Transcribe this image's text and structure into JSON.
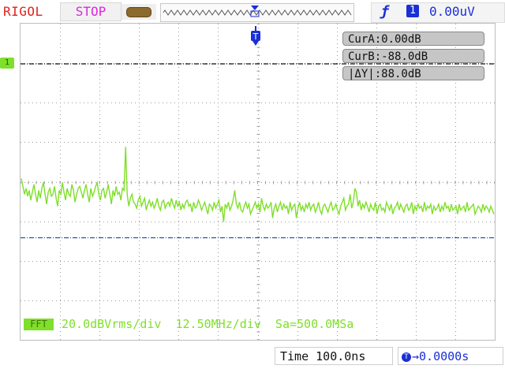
{
  "header": {
    "brand": "RIGOL",
    "run_state": "STOP",
    "trigger_source": "1",
    "trigger_level": "0.00uV"
  },
  "cursors": {
    "cur_a": "CurA:0.00dB",
    "cur_b": "CurB:-88.0dB",
    "delta_y": "|ΔY|:88.0dB"
  },
  "channel": {
    "marker": "1"
  },
  "fft": {
    "label": "FFT",
    "info": "20.0dBVrms/div  12.50MHz/div  Sa=500.0MSa"
  },
  "footer": {
    "timebase": "Time 100.0ns",
    "offset": "→0.0000s",
    "offset_marker": "T"
  },
  "colors": {
    "brand": "#e0201e",
    "stop": "#e026e0",
    "trigger": "#1a2fd6",
    "ch1_trace": "#7fdf2a",
    "cursor_a_line": "#111111",
    "cursor_b_line": "#1a4aa0"
  },
  "icons": [
    "memory-depth-icon",
    "trigger-edge-icon",
    "trigger-position-icon"
  ],
  "chart_data": {
    "type": "line",
    "series": [
      {
        "values": [
          -58,
          -62,
          -66,
          -63,
          -67,
          -64,
          -69,
          -65,
          -61,
          -66,
          -70,
          -64,
          -68,
          -63,
          -60,
          -66,
          -71,
          -65,
          -63,
          -67,
          -66,
          -62,
          -68,
          -72,
          -64,
          -66,
          -60,
          -65,
          -69,
          -63,
          -66,
          -67,
          -61,
          -64,
          -70,
          -66,
          -63,
          -62,
          -65,
          -68,
          -64,
          -61,
          -66,
          -70,
          -63,
          -67,
          -65,
          -62,
          -60,
          -66,
          -69,
          -64,
          -63,
          -68,
          -65,
          -61,
          -66,
          -71,
          -64,
          -67,
          -62,
          -66,
          -65,
          -69,
          -63,
          -64,
          -42,
          -66,
          -72,
          -68,
          -66,
          -70,
          -71,
          -73,
          -69,
          -67,
          -72,
          -70,
          -68,
          -74,
          -71,
          -69,
          -72,
          -70,
          -73,
          -71,
          -68,
          -72,
          -74,
          -70,
          -69,
          -73,
          -71,
          -70,
          -72,
          -68,
          -71,
          -73,
          -69,
          -72,
          -70,
          -74,
          -71,
          -73,
          -70,
          -69,
          -72,
          -71,
          -75,
          -70,
          -73,
          -72,
          -69,
          -71,
          -74,
          -72,
          -70,
          -73,
          -76,
          -71,
          -72,
          -74,
          -70,
          -73,
          -71,
          -69,
          -75,
          -72,
          -80,
          -71,
          -73,
          -70,
          -74,
          -72,
          -69,
          -64,
          -71,
          -73,
          -70,
          -74,
          -75,
          -72,
          -70,
          -73,
          -71,
          -76,
          -74,
          -72,
          -70,
          -73,
          -71,
          -75,
          -68,
          -72,
          -74,
          -71,
          -73,
          -72,
          -70,
          -78,
          -73,
          -71,
          -75,
          -72,
          -70,
          -74,
          -71,
          -73,
          -72,
          -76,
          -70,
          -74,
          -72,
          -71,
          -78,
          -73,
          -70,
          -74,
          -72,
          -75,
          -71,
          -73,
          -70,
          -74,
          -72,
          -71,
          -75,
          -73,
          -70,
          -74,
          -76,
          -72,
          -71,
          -73,
          -75,
          -72,
          -70,
          -74,
          -73,
          -71,
          -74,
          -76,
          -72,
          -70,
          -68,
          -74,
          -72,
          -71,
          -66,
          -73,
          -70,
          -63,
          -65,
          -72,
          -69,
          -74,
          -71,
          -73,
          -70,
          -72,
          -75,
          -71,
          -73,
          -74,
          -70,
          -76,
          -72,
          -71,
          -74,
          -73,
          -75,
          -70,
          -72,
          -74,
          -71,
          -76,
          -73,
          -72,
          -70,
          -74,
          -71,
          -73,
          -75,
          -72,
          -71,
          -74,
          -73,
          -70,
          -76,
          -72,
          -74,
          -71,
          -73,
          -72,
          -75,
          -70,
          -74,
          -72,
          -73,
          -71,
          -76,
          -72,
          -74,
          -73,
          -71,
          -75,
          -72,
          -74,
          -70,
          -73,
          -72,
          -75,
          -71,
          -74,
          -73,
          -72,
          -76,
          -71,
          -74,
          -73,
          -72,
          -75,
          -70,
          -74,
          -73,
          -72,
          -71,
          -76,
          -74,
          -72,
          -73,
          -75,
          -71,
          -74,
          -72,
          -73,
          -75,
          -72,
          -74,
          -76
        ]
      }
    ],
    "x_divisions": 12,
    "y_divisions": 8,
    "cursor_a_db": 0,
    "cursor_b_db": -88,
    "grid": true
  }
}
